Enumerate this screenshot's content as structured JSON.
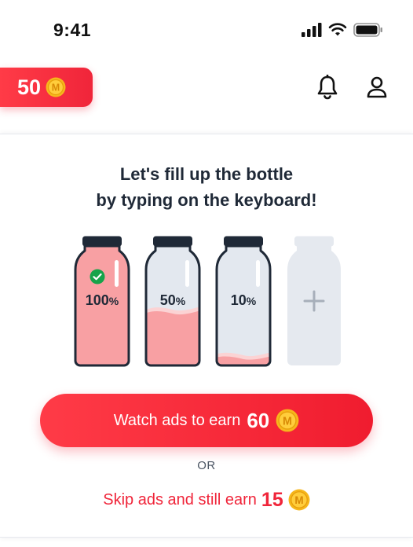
{
  "status_bar": {
    "time": "9:41",
    "icons": [
      "cellular-signal-icon",
      "wifi-icon",
      "battery-icon"
    ]
  },
  "header": {
    "coin_count": "50",
    "coin_icon": "m-coin-icon",
    "icons": [
      "bell-icon",
      "profile-icon"
    ]
  },
  "card": {
    "title_line1": "Let's fill up the bottle",
    "title_line2": "by typing on the keyboard!",
    "bottles": [
      {
        "percent": "100",
        "unit": "%",
        "fill_fraction": 1.0,
        "completed": true
      },
      {
        "percent": "50",
        "unit": "%",
        "fill_fraction": 0.5,
        "completed": false
      },
      {
        "percent": "10",
        "unit": "%",
        "fill_fraction": 0.1,
        "completed": false
      }
    ],
    "add_bottle_icon": "plus-icon"
  },
  "actions": {
    "watch_label": "Watch ads to earn",
    "watch_amount": "60",
    "or_text": "OR",
    "skip_label": "Skip ads and still earn",
    "skip_amount": "15"
  },
  "colors": {
    "brand_red": "#f0253a",
    "fill_pink": "#f8a0a3",
    "bottle_outline": "#1f2937",
    "bottle_empty": "#e3e8ef",
    "coin_gold": "#f6b71c",
    "check_green": "#16a34a"
  }
}
